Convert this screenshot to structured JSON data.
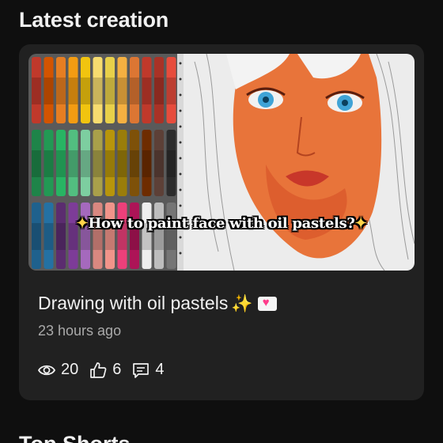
{
  "section": {
    "title": "Latest creation",
    "next_title": "Top Shorts"
  },
  "video": {
    "thumbnail_caption": "How to paint face with oil pastels?",
    "title": "Drawing with oil pastels",
    "time": "23 hours ago",
    "views": "20",
    "likes": "6",
    "comments": "4"
  },
  "icons": {
    "views": "eye-icon",
    "likes": "thumbs-up-icon",
    "comments": "comment-icon"
  },
  "colors": {
    "background": "#0f0f0f",
    "card": "#212121",
    "secondary_text": "#aaaaaa"
  }
}
